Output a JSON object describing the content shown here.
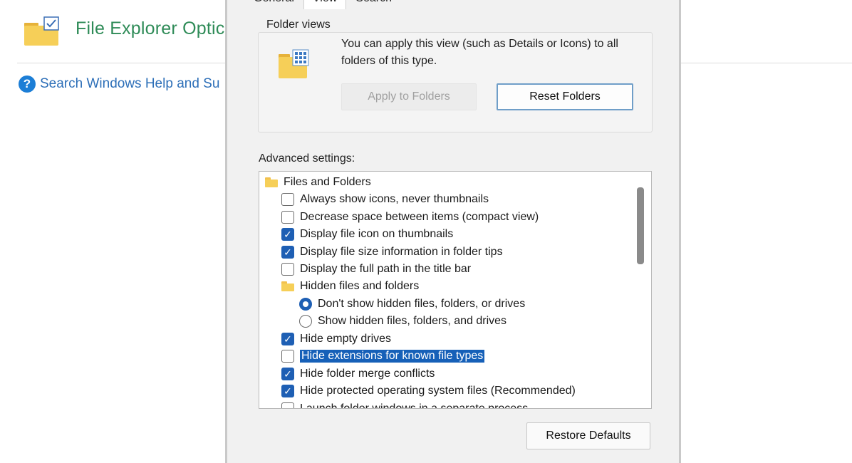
{
  "background": {
    "title": "File Explorer Optic",
    "help_link": "Search Windows Help and Su",
    "help_glyph": "?"
  },
  "dialog": {
    "tabs": [
      "General",
      "View",
      "Search"
    ],
    "active_tab": "View",
    "folder_views": {
      "group_label": "Folder views",
      "description": "You can apply this view (such as Details or Icons) to all folders of this type.",
      "apply_button": "Apply to Folders",
      "reset_button": "Reset Folders"
    },
    "advanced_label": "Advanced settings:",
    "advanced_items": [
      {
        "type": "folder",
        "label": "Files and Folders"
      },
      {
        "type": "checkbox",
        "label": "Always show icons, never thumbnails",
        "checked": false
      },
      {
        "type": "checkbox",
        "label": "Decrease space between items (compact view)",
        "checked": false
      },
      {
        "type": "checkbox",
        "label": "Display file icon on thumbnails",
        "checked": true
      },
      {
        "type": "checkbox",
        "label": "Display file size information in folder tips",
        "checked": true
      },
      {
        "type": "checkbox",
        "label": "Display the full path in the title bar",
        "checked": false
      },
      {
        "type": "folder",
        "label": "Hidden files and folders"
      },
      {
        "type": "radio",
        "label": "Don't show hidden files, folders, or drives",
        "checked": true
      },
      {
        "type": "radio",
        "label": "Show hidden files, folders, and drives",
        "checked": false
      },
      {
        "type": "checkbox",
        "label": "Hide empty drives",
        "checked": true
      },
      {
        "type": "checkbox",
        "label": "Hide extensions for known file types",
        "checked": false,
        "selected": true
      },
      {
        "type": "checkbox",
        "label": "Hide folder merge conflicts",
        "checked": true
      },
      {
        "type": "checkbox",
        "label": "Hide protected operating system files (Recommended)",
        "checked": true
      },
      {
        "type": "checkbox",
        "label": "Launch folder windows in a separate process",
        "checked": false
      }
    ],
    "restore_button": "Restore Defaults",
    "colors": {
      "accent": "#1e5fb4",
      "selection": "#1660b8",
      "title_green": "#2e8b57"
    }
  }
}
